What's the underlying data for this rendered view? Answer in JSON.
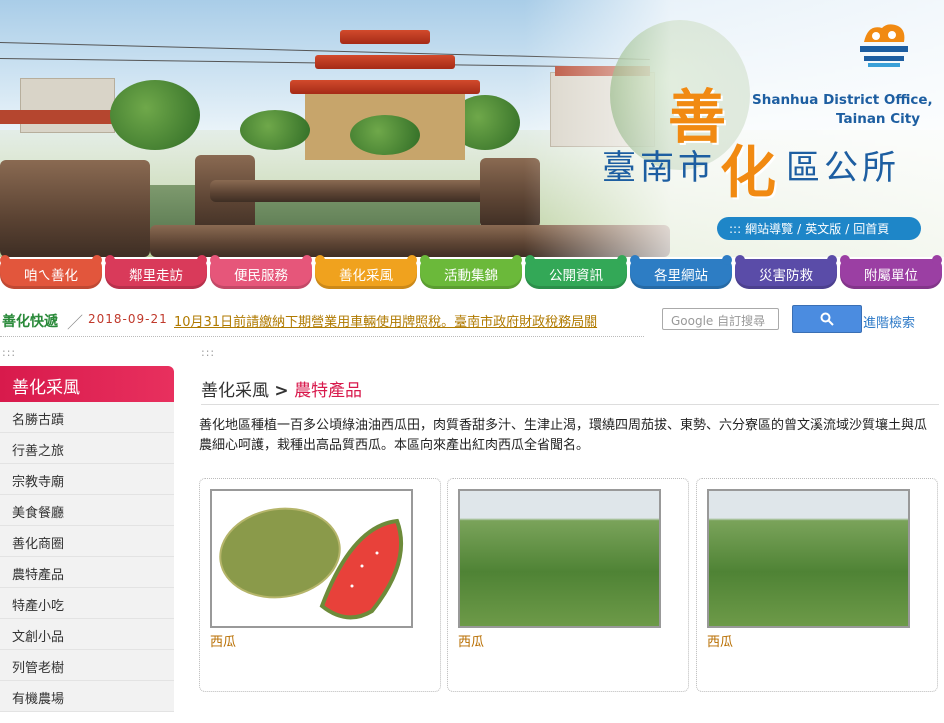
{
  "header": {
    "title_char1": "善",
    "title_char2": "化",
    "subtitle_prefix": "臺南市",
    "subtitle_suffix": "區公所",
    "english_line1": "Shanhua District Office,",
    "english_line2": "Tainan City",
    "top_links": [
      ":::",
      "網站導覽",
      "英文版",
      "回首頁"
    ],
    "colors": {
      "brand_orange": "#f18a12",
      "brand_blue": "#1d5ea1"
    }
  },
  "menu": [
    {
      "label": "咱ㄟ善化",
      "color": "#e2563c"
    },
    {
      "label": "鄰里走訪",
      "color": "#d93a5a"
    },
    {
      "label": "便民服務",
      "color": "#e6567a"
    },
    {
      "label": "善化采風",
      "color": "#f0a21e"
    },
    {
      "label": "活動集錦",
      "color": "#6bb93a"
    },
    {
      "label": "公開資訊",
      "color": "#33a857"
    },
    {
      "label": "各里網站",
      "color": "#2d7dc4"
    },
    {
      "label": "災害防救",
      "color": "#5a4ca8"
    },
    {
      "label": "附屬單位",
      "color": "#9b3fa3"
    }
  ],
  "ticker": {
    "title": "善化快遞",
    "date": "2018-09-21",
    "text": "10月31日前請繳納下期營業用車輛使用牌照稅。臺南市政府財政稅務局關"
  },
  "search": {
    "placeholder": "Google 自訂搜尋",
    "button_icon": "search-icon",
    "advanced": "進階檢索"
  },
  "sidebar": {
    "title": "善化采風",
    "items": [
      "名勝古蹟",
      "行善之旅",
      "宗教寺廟",
      "美食餐廳",
      "善化商圈",
      "農特產品",
      "特產小吃",
      "文創小品",
      "列管老樹",
      "有機農場"
    ]
  },
  "content": {
    "dots": ":::",
    "crumb_parent": "善化采風",
    "crumb_sep": ">",
    "crumb_current": "農特產品",
    "intro": "善化地區種植一百多公頃綠油油西瓜田，肉質香甜多汁、生津止渴，環繞四周茄拔、東勢、六分寮區的曾文溪流域沙質壤土與瓜農細心呵護，栽種出高品質西瓜。本區向來產出紅肉西瓜全省聞名。",
    "cards": [
      {
        "caption": "西瓜"
      },
      {
        "caption": "西瓜"
      },
      {
        "caption": "西瓜"
      }
    ]
  }
}
